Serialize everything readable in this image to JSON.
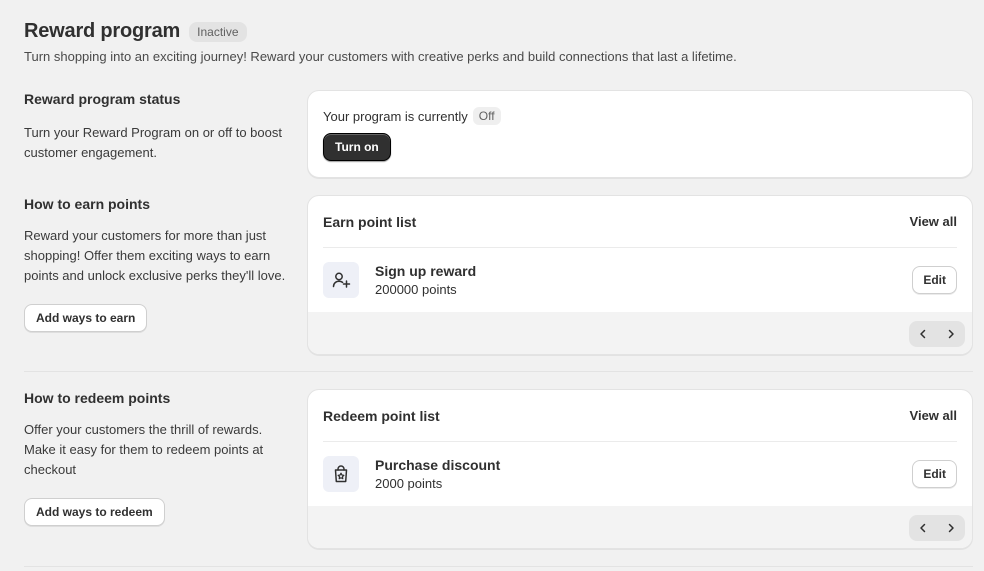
{
  "header": {
    "title": "Reward program",
    "status_badge": "Inactive",
    "subtitle": "Turn shopping into an exciting journey! Reward your customers with creative perks and build connections that last a lifetime."
  },
  "status_section": {
    "heading": "Reward program status",
    "description": "Turn your Reward Program on or off to boost customer engagement.",
    "status_text": "Your program is currently",
    "status_value": "Off",
    "toggle_label": "Turn on"
  },
  "earn_section": {
    "heading": "How to earn points",
    "description": "Reward your customers for more than just shopping! Offer them exciting ways to earn points and unlock exclusive perks they'll love.",
    "add_button": "Add ways to earn",
    "card_title": "Earn point list",
    "view_all": "View all",
    "items": [
      {
        "icon": "user-add-icon",
        "name": "Sign up reward",
        "points": "200000 points",
        "edit": "Edit"
      }
    ]
  },
  "redeem_section": {
    "heading": "How to redeem points",
    "description": "Offer your customers the thrill of rewards. Make it easy for them to redeem points at checkout",
    "add_button": "Add ways to redeem",
    "card_title": "Redeem point list",
    "view_all": "View all",
    "items": [
      {
        "icon": "shopping-bag-star-icon",
        "name": "Purchase discount",
        "points": "2000 points",
        "edit": "Edit"
      }
    ]
  }
}
